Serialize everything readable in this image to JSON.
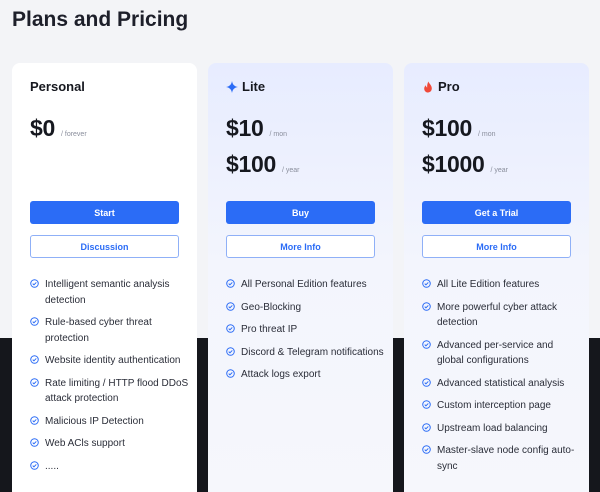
{
  "page": {
    "title": "Plans and Pricing"
  },
  "colors": {
    "accent": "#2b6cf6",
    "pro_icon": "#f04a3a"
  },
  "plans": [
    {
      "name": "Personal",
      "icon": null,
      "prices": [
        {
          "amount": "$0",
          "period": "/ forever"
        }
      ],
      "primary_button": "Start",
      "secondary_button": "Discussion",
      "features": [
        "Intelligent semantic analysis detection",
        "Rule-based cyber threat protection",
        "Website identity authentication",
        "Rate limiting / HTTP flood DDoS attack protection",
        "Malicious IP Detection",
        "Web ACls support",
        "....."
      ]
    },
    {
      "name": "Lite",
      "icon": "sparkle-icon",
      "prices": [
        {
          "amount": "$10",
          "period": "/ mon"
        },
        {
          "amount": "$100",
          "period": "/ year"
        }
      ],
      "primary_button": "Buy",
      "secondary_button": "More Info",
      "features": [
        "All Personal Edition features",
        "Geo-Blocking",
        "Pro threat IP",
        "Discord & Telegram notifications",
        "Attack logs export"
      ]
    },
    {
      "name": "Pro",
      "icon": "flame-icon",
      "prices": [
        {
          "amount": "$100",
          "period": "/ mon"
        },
        {
          "amount": "$1000",
          "period": "/ year"
        }
      ],
      "primary_button": "Get a Trial",
      "secondary_button": "More Info",
      "features": [
        "All Lite Edition features",
        "More powerful cyber attack detection",
        "Advanced per-service and global configurations",
        "Advanced statistical analysis",
        "Custom interception page",
        "Upstream load balancing",
        "Master-slave node config auto-sync"
      ]
    }
  ]
}
